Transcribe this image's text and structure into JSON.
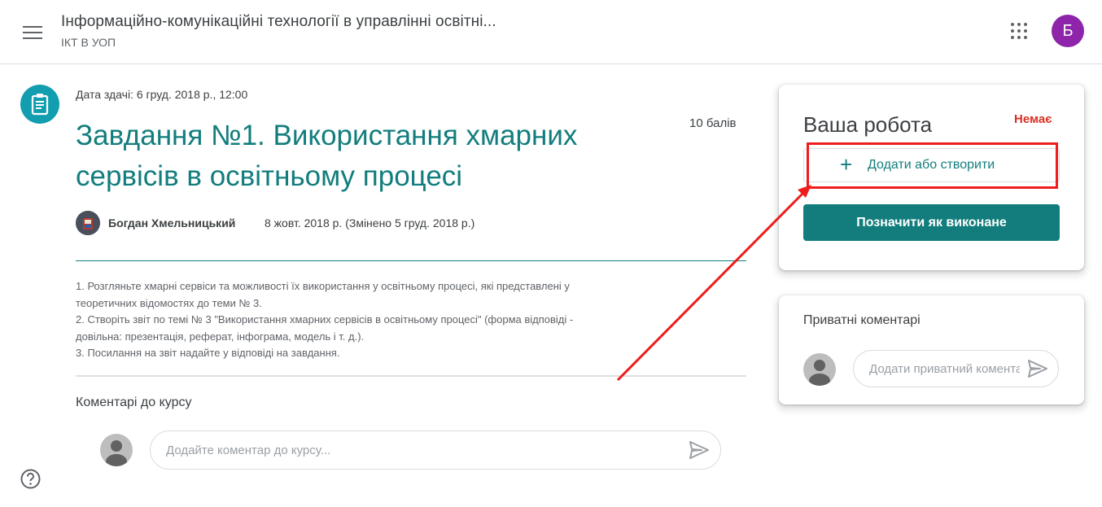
{
  "header": {
    "course_title": "Інформаційно-комунікаційні технології в управлінні освітні...",
    "course_subtitle": "ІКТ В УОП",
    "avatar_letter": "Б"
  },
  "assignment": {
    "due": "Дата здачі: 6 груд. 2018 р., 12:00",
    "title": "Завдання №1. Використання хмарних сервісів в освітньому процесі",
    "points": "10 балів",
    "author": "Богдан Хмельницький",
    "date": "8 жовт. 2018 р. (Змінено 5 груд. 2018 р.)",
    "description": [
      "1. Розгляньте хмарні сервіси та можливості їх використання у освітньому процесі, які представлені у",
      "теоретичних відомостях до теми № 3.",
      "2. Створіть звіт по темі № 3 \"Використання хмарних сервісів в освітньому процесі\" (форма відповіді -",
      "довільна: презентація, реферат, інфограма, модель і т. д.).",
      "3. Посилання на звіт надайте у відповіді на завдання."
    ]
  },
  "class_comments": {
    "heading": "Коментарі до курсу",
    "placeholder": "Додайте коментар до курсу..."
  },
  "your_work": {
    "heading": "Ваша робота",
    "status": "Немає",
    "add_label": "Додати або створити",
    "done_label": "Позначити як виконане"
  },
  "private_comments": {
    "heading": "Приватні коментарі",
    "placeholder": "Додати приватний коментар..."
  },
  "colors": {
    "accent": "#137d7d",
    "status": "#d93025",
    "annotation": "#ee1c1c",
    "avatar": "#8e24aa"
  },
  "icons": [
    "menu-icon",
    "apps-grid-icon",
    "assignment-icon",
    "send-icon",
    "help-icon",
    "plus-icon",
    "default-avatar-icon"
  ]
}
